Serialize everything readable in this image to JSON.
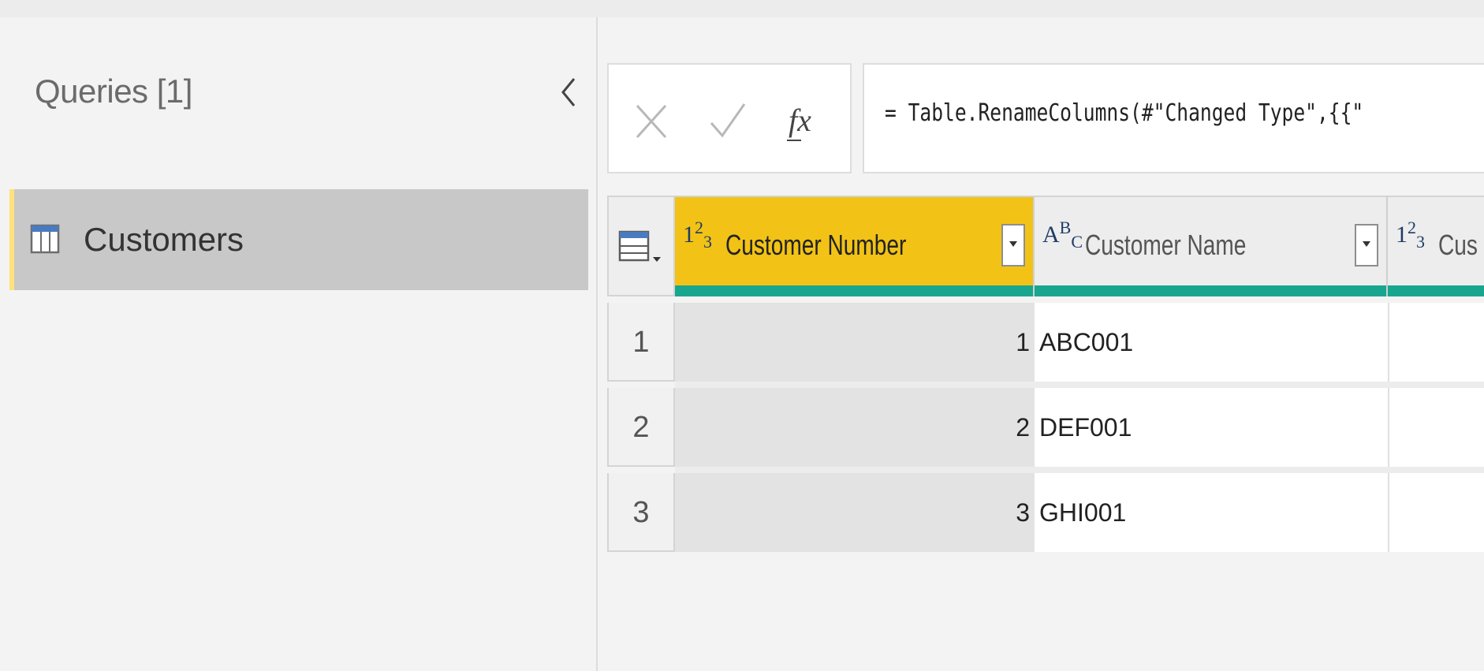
{
  "queries_pane": {
    "title": "Queries [1]",
    "items": [
      {
        "label": "Customers",
        "icon": "table-icon",
        "selected": true
      }
    ],
    "collapse_icon": "chevron-left-icon"
  },
  "formula_bar": {
    "cancel_icon": "close-icon",
    "commit_icon": "check-icon",
    "fx_label": "fx",
    "formula": "= Table.RenameColumns(#\"Changed Type\",{{\""
  },
  "grid": {
    "corner_icon": "table-menu-icon",
    "columns": [
      {
        "type": "number",
        "type_label_a": "1",
        "type_label_b": "2",
        "type_label_c": "3",
        "name": "Customer Number",
        "selected": true
      },
      {
        "type": "text",
        "type_label_a": "A",
        "type_label_b": "B",
        "type_label_c": "C",
        "name": "Customer Name",
        "selected": false
      },
      {
        "type": "number",
        "type_label_a": "1",
        "type_label_b": "2",
        "type_label_c": "3",
        "name": "Cus",
        "selected": false
      }
    ],
    "rows": [
      {
        "index": "1",
        "customer_number": "1",
        "customer_name": "ABC001",
        "third": ""
      },
      {
        "index": "2",
        "customer_number": "2",
        "customer_name": "DEF001",
        "third": ""
      },
      {
        "index": "3",
        "customer_number": "3",
        "customer_name": "GHI001",
        "third": ""
      }
    ]
  },
  "colors": {
    "selected_header": "#f2c316",
    "column_quality": "#18a68f",
    "query_selected_bg": "#c8c8c8"
  }
}
